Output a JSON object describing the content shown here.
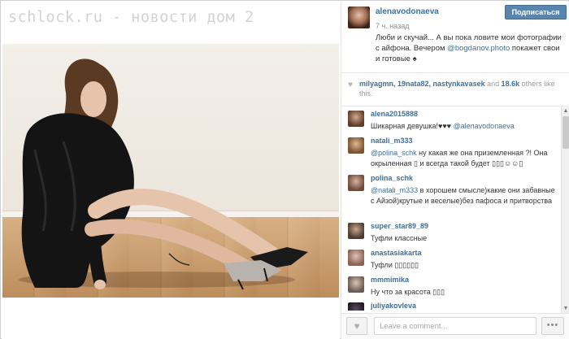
{
  "watermark": "schlock.ru - новости дом 2",
  "post": {
    "username": "alenavodonaeva",
    "time_ago": "7 ч. назад",
    "follow_label": "Подписаться",
    "caption_before": "Люби и скучай... А вы пока ловите мои фотографии с айфона. Вечером ",
    "caption_mention": "@bogdanov.photo",
    "caption_after": " покажет свои и готовые ♠"
  },
  "likes": {
    "users": "milyagmn, 19nata82, nastynkavasek",
    "connector": " and ",
    "others": "18.6k",
    "suffix": " others like this."
  },
  "comments": [
    {
      "user": "alena2015888",
      "text_before": "Шикарная девушка!♥♥♥ ",
      "mention": "@alenavodonaeva",
      "text_after": ""
    },
    {
      "user": "natali_m333",
      "text_before": "",
      "mention": "@polina_schk",
      "text_after": " ну какая же она приземленная ?! Она окрыленная ▯ и всегда такой будет ▯▯▯☺☺▯"
    },
    {
      "user": "polina_schk",
      "text_before": "",
      "mention": "@natali_m333",
      "text_after": " в хорошем смысле)какие они забавные с Айзой)крутые и веселые)без пафоса и притворства"
    },
    {
      "user": "super_star89_89",
      "text_before": "Туфли классные",
      "mention": "",
      "text_after": ""
    },
    {
      "user": "anastasiakarta",
      "text_before": "Туфли ▯▯▯▯▯▯",
      "mention": "",
      "text_after": ""
    },
    {
      "user": "mmmimika",
      "text_before": "Ну что за красота ▯▯▯",
      "mention": "",
      "text_after": ""
    },
    {
      "user": "juliyakovleva",
      "text_before": "",
      "mention": "",
      "text_after": ""
    }
  ],
  "composer": {
    "placeholder": "Leave a comment...",
    "more_label": "•••"
  },
  "colors": {
    "link": "#3f6f98",
    "follow_button": "#5a86ae"
  },
  "icons": {
    "like_small": "heart-icon",
    "like_button": "heart-icon",
    "more": "ellipsis-icon"
  }
}
